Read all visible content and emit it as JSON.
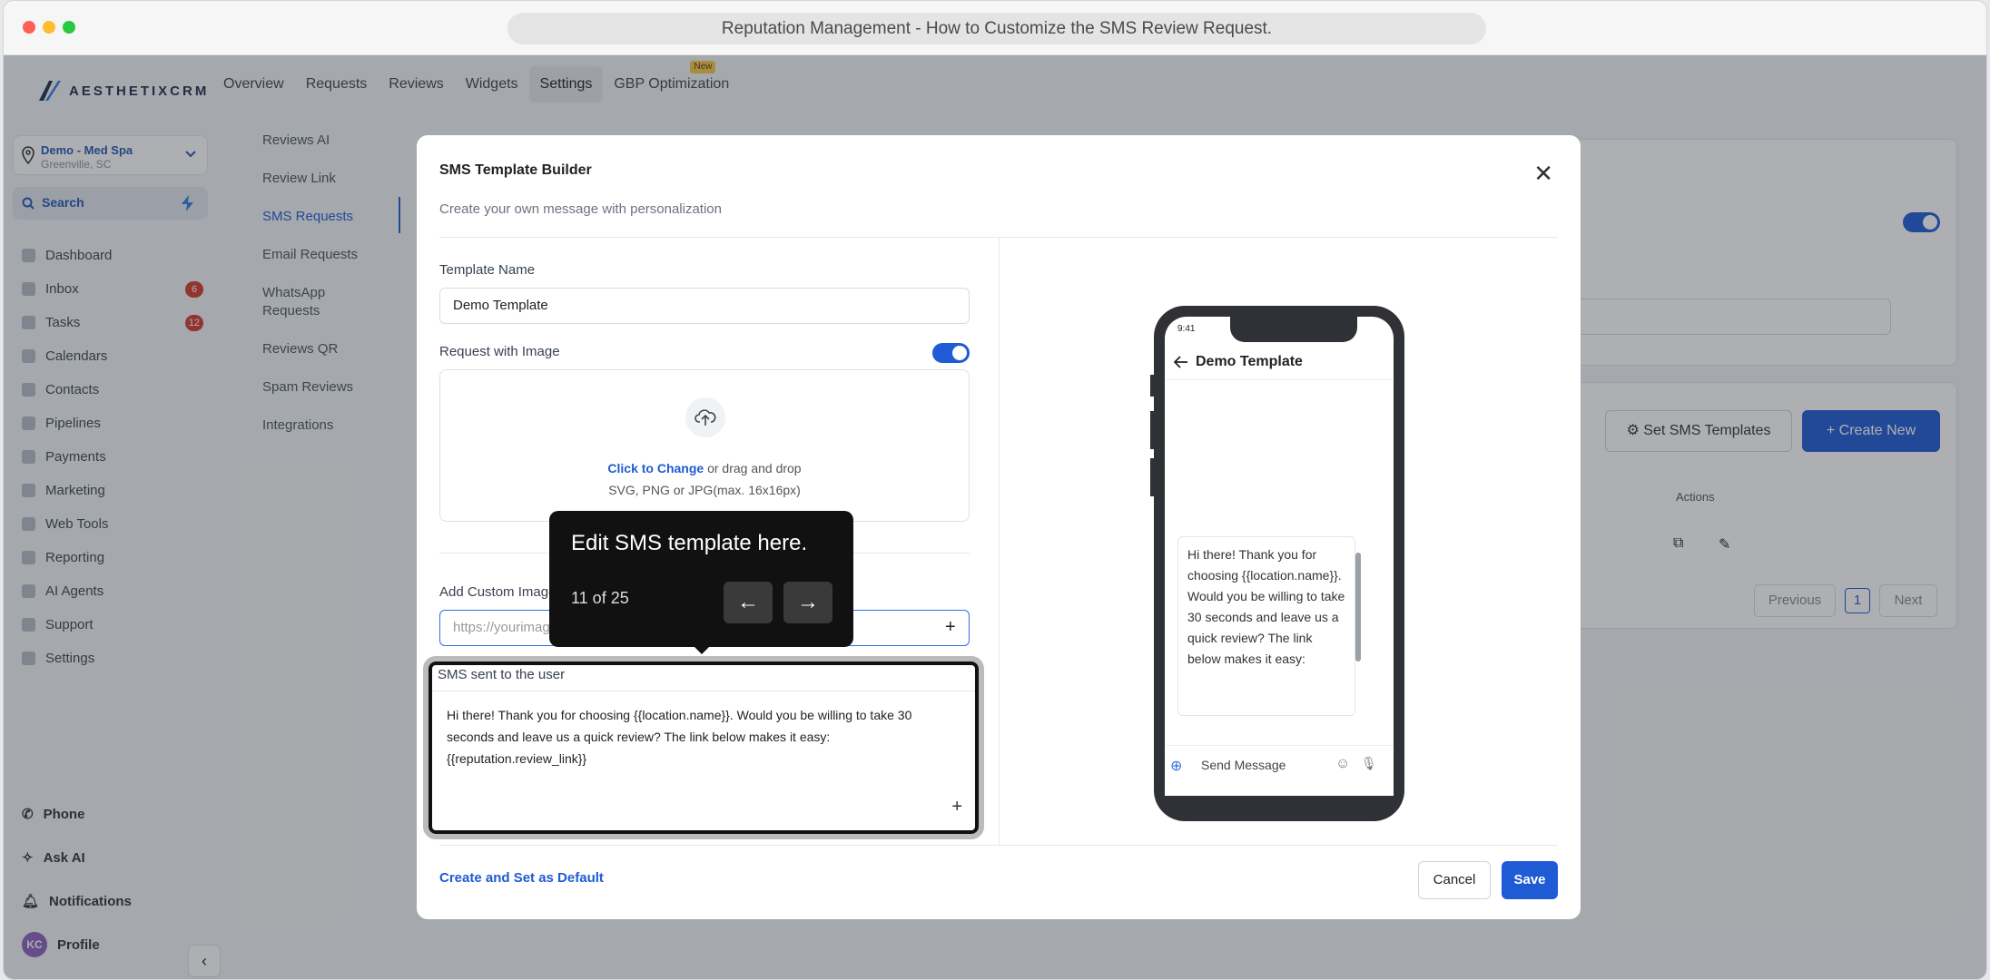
{
  "browser": {
    "title": "Reputation Management - How to Customize the SMS Review Request."
  },
  "brand": {
    "logo": "AESTHETIXCRM",
    "accent": "#1f5bd5"
  },
  "location": {
    "name": "Demo - Med Spa",
    "city": "Greenville, SC"
  },
  "search": {
    "label": "Search"
  },
  "nav": [
    {
      "label": "Dashboard",
      "badge": ""
    },
    {
      "label": "Inbox",
      "badge": "6"
    },
    {
      "label": "Tasks",
      "badge": "12"
    },
    {
      "label": "Calendars",
      "badge": ""
    },
    {
      "label": "Contacts",
      "badge": ""
    },
    {
      "label": "Pipelines",
      "badge": ""
    },
    {
      "label": "Payments",
      "badge": ""
    },
    {
      "label": "Marketing",
      "badge": ""
    },
    {
      "label": "Web Tools",
      "badge": ""
    },
    {
      "label": "Reporting",
      "badge": ""
    },
    {
      "label": "AI Agents",
      "badge": ""
    },
    {
      "label": "Support",
      "badge": ""
    },
    {
      "label": "Settings",
      "badge": ""
    }
  ],
  "bottom_nav": {
    "phone": "Phone",
    "ask_ai": "Ask AI",
    "notifications": "Notifications",
    "profile": "Profile",
    "avatar": "KC"
  },
  "topnav": {
    "tabs": [
      "Overview",
      "Requests",
      "Reviews",
      "Widgets",
      "Settings",
      "GBP Optimization"
    ],
    "new_badge": "New"
  },
  "subnav": [
    "Reviews AI",
    "Review Link",
    "SMS Requests",
    "Email Requests",
    "WhatsApp Requests",
    "Reviews QR",
    "Spam Reviews",
    "Integrations"
  ],
  "background": {
    "set_templates": "Set SMS Templates",
    "create_new": "Create New",
    "actions": "Actions",
    "previous": "Previous",
    "page": "1",
    "next": "Next"
  },
  "modal": {
    "title": "SMS Template Builder",
    "subtitle": "Create your own message with personalization",
    "template_name_label": "Template Name",
    "template_name_value": "Demo Template",
    "request_with_image_label": "Request with Image",
    "upload_link": "Click to Change",
    "upload_rest": " or drag and drop",
    "upload_formats": "SVG, PNG or JPG(max. 16x16px)",
    "custom_image_label": "Add Custom Image",
    "custom_image_placeholder": "https://yourimage",
    "sms_label": "SMS sent to the user",
    "sms_text": "Hi there! Thank you for choosing {{location.name}}. Would you be willing to take 30 seconds and leave us a quick review? The link below makes it easy: {{reputation.review_link}}",
    "default_link": "Create and Set as Default",
    "cancel": "Cancel",
    "save": "Save"
  },
  "preview": {
    "time": "9:41",
    "contact": "Demo Template",
    "message": "Hi there! Thank you for choosing {{location.name}}. Would you be willing to take 30 seconds and leave us a quick review? The link below makes it easy:",
    "input_placeholder": "Send Message"
  },
  "tooltip": {
    "text": "Edit SMS template here.",
    "counter": "11 of 25"
  }
}
